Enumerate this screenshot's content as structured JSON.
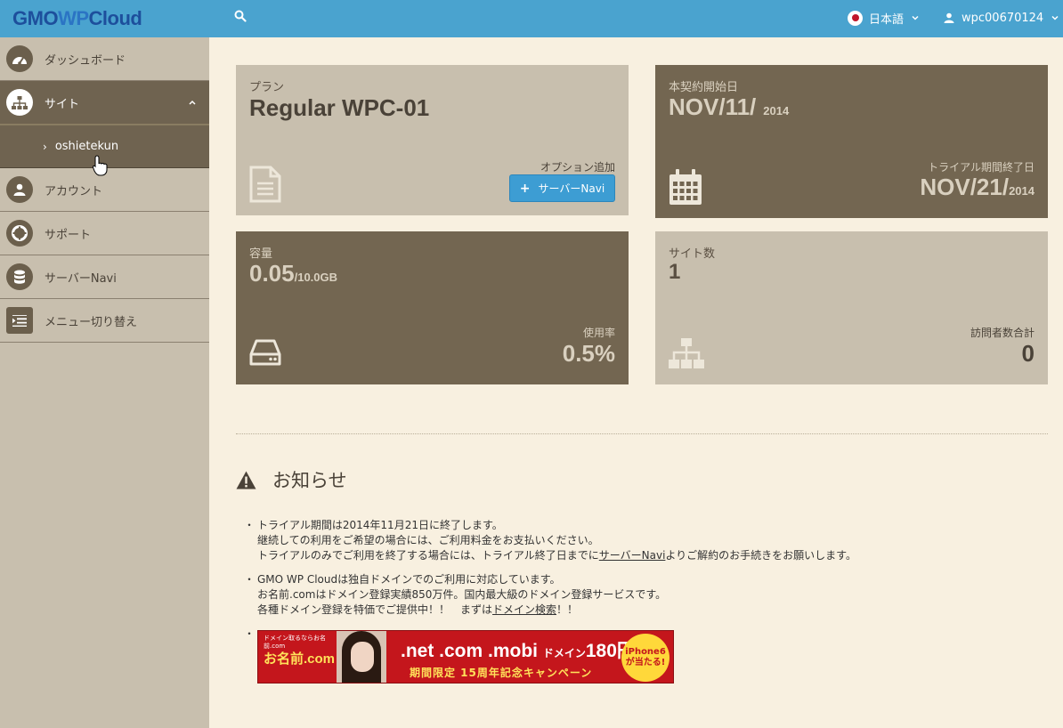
{
  "header": {
    "logo_gmo": "GMO",
    "logo_wp": "WP",
    "logo_cloud": "Cloud",
    "language": "日本語",
    "user": "wpc00670124"
  },
  "sidebar": {
    "items": [
      {
        "label": "ダッシュボード"
      },
      {
        "label": "サイト"
      },
      {
        "label": "oshietekun"
      },
      {
        "label": "アカウント"
      },
      {
        "label": "サポート"
      },
      {
        "label": "サーバーNavi"
      },
      {
        "label": "メニュー切り替え"
      }
    ]
  },
  "cards": {
    "plan": {
      "label": "プラン",
      "value": "Regular WPC-01",
      "option_label": "オプション追加",
      "button": "サーバーNavi"
    },
    "contract": {
      "label": "本契約開始日",
      "date": "NOV/11/",
      "year": "2014",
      "end_label": "トライアル期間終了日",
      "end_date": "NOV/21/",
      "end_year": "2014"
    },
    "capacity": {
      "label": "容量",
      "value": "0.05",
      "total": "/10.0GB",
      "usage_label": "使用率",
      "usage_value": "0.5%"
    },
    "sites": {
      "label": "サイト数",
      "value": "1",
      "visitors_label": "訪問者数合計",
      "visitors_value": "0"
    }
  },
  "notice": {
    "title": "お知らせ",
    "item1": {
      "line1": "トライアル期間は2014年11月21日に終了します。",
      "line2": "継続しての利用をご希望の場合には、ご利用料金をお支払いください。",
      "line3_pre": "トライアルのみでご利用を終了する場合には、トライアル終了日までに",
      "line3_link": "サーバーNavi",
      "line3_post": "よりご解約のお手続きをお願いします。"
    },
    "item2": {
      "line1": "GMO WP Cloudは独自ドメインでのご利用に対応しています。",
      "line2": "お名前.comはドメイン登録実績850万件。国内最大級のドメイン登録サービスです。",
      "line3_pre": "各種ドメイン登録を特価でご提供中！！　まずは",
      "line3_link": "ドメイン検索",
      "line3_post": "！！"
    }
  },
  "banner": {
    "top_text": "ドメイン取るならお名前.com",
    "brand": "お名前.com",
    "main": ".net .com .mobi",
    "domain_word": "ドメイン",
    "price": "180円",
    "sub": "期間限定 15周年記念キャンペーン",
    "badge_line1": "iPhone6",
    "badge_line2": "が当たる!"
  },
  "colors": {
    "topbar": "#4aa3cf",
    "sidebar": "#c8bfae",
    "active": "#6f6350",
    "card_dark": "#736651",
    "card_light": "#c8bfae",
    "background": "#f8f0e0",
    "button": "#3d9dd3"
  }
}
